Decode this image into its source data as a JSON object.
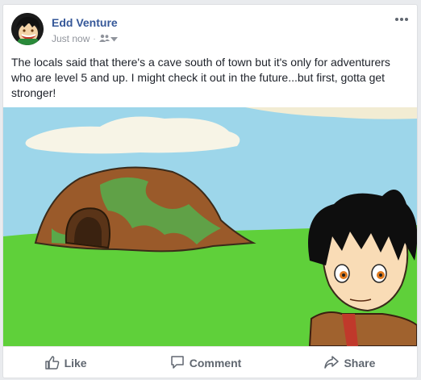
{
  "post": {
    "author": "Edd Venture",
    "timestamp": "Just now",
    "separator": "·",
    "text": "The locals said that there's a cave south of town but it's only for adventurers who are level 5 and up. I might check it out in the future...but first, gotta get stronger!",
    "more_icon": "ellipsis-icon",
    "audience_icon": "friends-icon"
  },
  "actions": {
    "like": "Like",
    "comment": "Comment",
    "share": "Share"
  },
  "colors": {
    "author": "#365899",
    "sky": "#9dd6ea",
    "grass": "#5fd03a",
    "cave": "#9a5a2a"
  }
}
